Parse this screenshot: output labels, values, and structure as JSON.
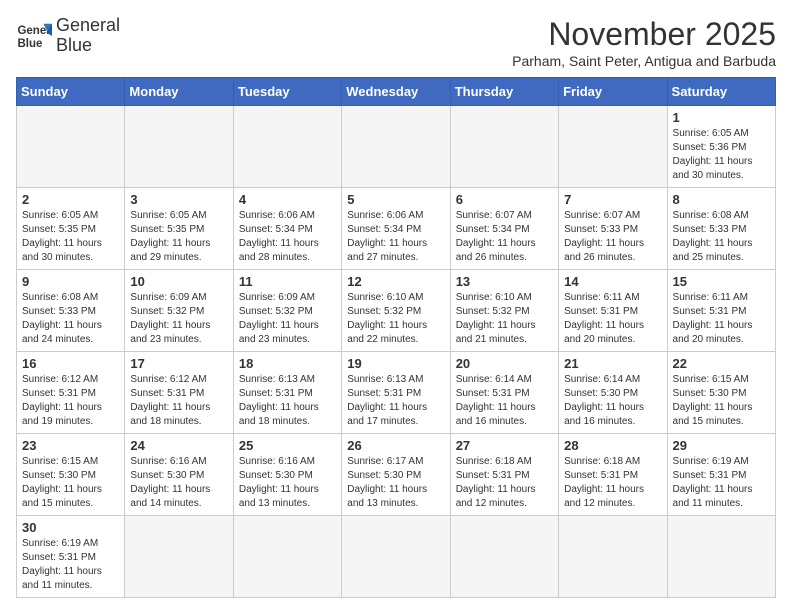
{
  "logo": {
    "line1": "General",
    "line2": "Blue"
  },
  "title": "November 2025",
  "subtitle": "Parham, Saint Peter, Antigua and Barbuda",
  "days_of_week": [
    "Sunday",
    "Monday",
    "Tuesday",
    "Wednesday",
    "Thursday",
    "Friday",
    "Saturday"
  ],
  "weeks": [
    [
      {
        "day": "",
        "info": ""
      },
      {
        "day": "",
        "info": ""
      },
      {
        "day": "",
        "info": ""
      },
      {
        "day": "",
        "info": ""
      },
      {
        "day": "",
        "info": ""
      },
      {
        "day": "",
        "info": ""
      },
      {
        "day": "1",
        "info": "Sunrise: 6:05 AM\nSunset: 5:36 PM\nDaylight: 11 hours\nand 30 minutes."
      }
    ],
    [
      {
        "day": "2",
        "info": "Sunrise: 6:05 AM\nSunset: 5:35 PM\nDaylight: 11 hours\nand 30 minutes."
      },
      {
        "day": "3",
        "info": "Sunrise: 6:05 AM\nSunset: 5:35 PM\nDaylight: 11 hours\nand 29 minutes."
      },
      {
        "day": "4",
        "info": "Sunrise: 6:06 AM\nSunset: 5:34 PM\nDaylight: 11 hours\nand 28 minutes."
      },
      {
        "day": "5",
        "info": "Sunrise: 6:06 AM\nSunset: 5:34 PM\nDaylight: 11 hours\nand 27 minutes."
      },
      {
        "day": "6",
        "info": "Sunrise: 6:07 AM\nSunset: 5:34 PM\nDaylight: 11 hours\nand 26 minutes."
      },
      {
        "day": "7",
        "info": "Sunrise: 6:07 AM\nSunset: 5:33 PM\nDaylight: 11 hours\nand 26 minutes."
      },
      {
        "day": "8",
        "info": "Sunrise: 6:08 AM\nSunset: 5:33 PM\nDaylight: 11 hours\nand 25 minutes."
      }
    ],
    [
      {
        "day": "9",
        "info": "Sunrise: 6:08 AM\nSunset: 5:33 PM\nDaylight: 11 hours\nand 24 minutes."
      },
      {
        "day": "10",
        "info": "Sunrise: 6:09 AM\nSunset: 5:32 PM\nDaylight: 11 hours\nand 23 minutes."
      },
      {
        "day": "11",
        "info": "Sunrise: 6:09 AM\nSunset: 5:32 PM\nDaylight: 11 hours\nand 23 minutes."
      },
      {
        "day": "12",
        "info": "Sunrise: 6:10 AM\nSunset: 5:32 PM\nDaylight: 11 hours\nand 22 minutes."
      },
      {
        "day": "13",
        "info": "Sunrise: 6:10 AM\nSunset: 5:32 PM\nDaylight: 11 hours\nand 21 minutes."
      },
      {
        "day": "14",
        "info": "Sunrise: 6:11 AM\nSunset: 5:31 PM\nDaylight: 11 hours\nand 20 minutes."
      },
      {
        "day": "15",
        "info": "Sunrise: 6:11 AM\nSunset: 5:31 PM\nDaylight: 11 hours\nand 20 minutes."
      }
    ],
    [
      {
        "day": "16",
        "info": "Sunrise: 6:12 AM\nSunset: 5:31 PM\nDaylight: 11 hours\nand 19 minutes."
      },
      {
        "day": "17",
        "info": "Sunrise: 6:12 AM\nSunset: 5:31 PM\nDaylight: 11 hours\nand 18 minutes."
      },
      {
        "day": "18",
        "info": "Sunrise: 6:13 AM\nSunset: 5:31 PM\nDaylight: 11 hours\nand 18 minutes."
      },
      {
        "day": "19",
        "info": "Sunrise: 6:13 AM\nSunset: 5:31 PM\nDaylight: 11 hours\nand 17 minutes."
      },
      {
        "day": "20",
        "info": "Sunrise: 6:14 AM\nSunset: 5:31 PM\nDaylight: 11 hours\nand 16 minutes."
      },
      {
        "day": "21",
        "info": "Sunrise: 6:14 AM\nSunset: 5:30 PM\nDaylight: 11 hours\nand 16 minutes."
      },
      {
        "day": "22",
        "info": "Sunrise: 6:15 AM\nSunset: 5:30 PM\nDaylight: 11 hours\nand 15 minutes."
      }
    ],
    [
      {
        "day": "23",
        "info": "Sunrise: 6:15 AM\nSunset: 5:30 PM\nDaylight: 11 hours\nand 15 minutes."
      },
      {
        "day": "24",
        "info": "Sunrise: 6:16 AM\nSunset: 5:30 PM\nDaylight: 11 hours\nand 14 minutes."
      },
      {
        "day": "25",
        "info": "Sunrise: 6:16 AM\nSunset: 5:30 PM\nDaylight: 11 hours\nand 13 minutes."
      },
      {
        "day": "26",
        "info": "Sunrise: 6:17 AM\nSunset: 5:30 PM\nDaylight: 11 hours\nand 13 minutes."
      },
      {
        "day": "27",
        "info": "Sunrise: 6:18 AM\nSunset: 5:31 PM\nDaylight: 11 hours\nand 12 minutes."
      },
      {
        "day": "28",
        "info": "Sunrise: 6:18 AM\nSunset: 5:31 PM\nDaylight: 11 hours\nand 12 minutes."
      },
      {
        "day": "29",
        "info": "Sunrise: 6:19 AM\nSunset: 5:31 PM\nDaylight: 11 hours\nand 11 minutes."
      }
    ],
    [
      {
        "day": "30",
        "info": "Sunrise: 6:19 AM\nSunset: 5:31 PM\nDaylight: 11 hours\nand 11 minutes."
      },
      {
        "day": "",
        "info": ""
      },
      {
        "day": "",
        "info": ""
      },
      {
        "day": "",
        "info": ""
      },
      {
        "day": "",
        "info": ""
      },
      {
        "day": "",
        "info": ""
      },
      {
        "day": "",
        "info": ""
      }
    ]
  ]
}
